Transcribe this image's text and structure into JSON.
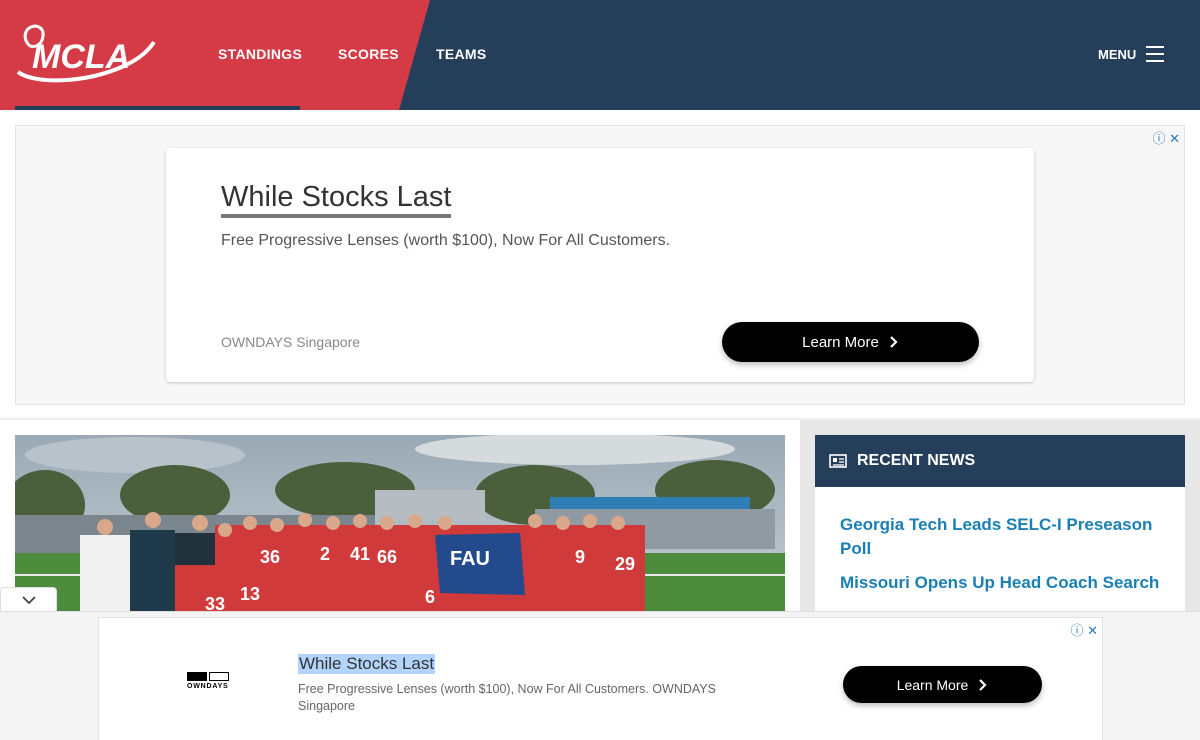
{
  "header": {
    "logo_alt": "MCLA",
    "nav": {
      "standings": "STANDINGS",
      "scores": "SCORES",
      "teams": "TEAMS"
    },
    "menu_label": "MENU"
  },
  "ad_top": {
    "headline": "While Stocks Last",
    "description": "Free Progressive Lenses (worth $100), Now For All Customers.",
    "advertiser": "OWNDAYS Singapore",
    "button_label": "Learn More",
    "info_icon": "ⓘ",
    "close_icon": "✕"
  },
  "sidebar": {
    "heading": "RECENT NEWS",
    "items": [
      {
        "title": "Georgia Tech Leads SELC-I Preseason Poll"
      },
      {
        "title": "Missouri Opens Up Head Coach Search"
      }
    ]
  },
  "ad_bottom": {
    "brand_logo_text": "OWNDAYS",
    "headline": "While Stocks Last",
    "description": "Free Progressive Lenses (worth $100), Now For All Customers. OWNDAYS Singapore",
    "button_label": "Learn More",
    "info_icon": "ⓘ",
    "close_icon": "✕"
  },
  "colors": {
    "header_red": "#d43b46",
    "header_navy": "#253f5b",
    "news_link": "#1a80b4"
  }
}
